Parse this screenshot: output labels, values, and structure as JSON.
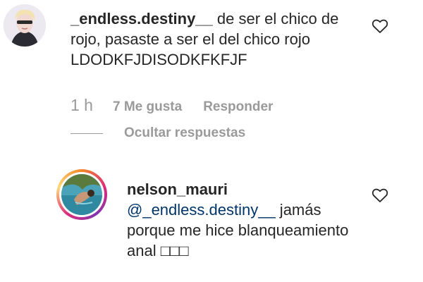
{
  "comment": {
    "username": "_endless.destiny__",
    "text": " de ser el chico de rojo, pasaste a ser el del chico rojo LDODKFJDISODKFKFJF",
    "time": "1 h",
    "likes": "7 Me gusta",
    "reply_label": "Responder",
    "hide_replies_label": "Ocultar respuestas"
  },
  "reply": {
    "username": "nelson_mauri",
    "mention": "@_endless.destiny__",
    "text": " jamás porque me hice blanqueamiento anal □□□"
  },
  "icons": {
    "like": "heart-outline-icon"
  },
  "colors": {
    "text": "#262626",
    "muted": "#9a9a9a",
    "mention": "#003569"
  }
}
